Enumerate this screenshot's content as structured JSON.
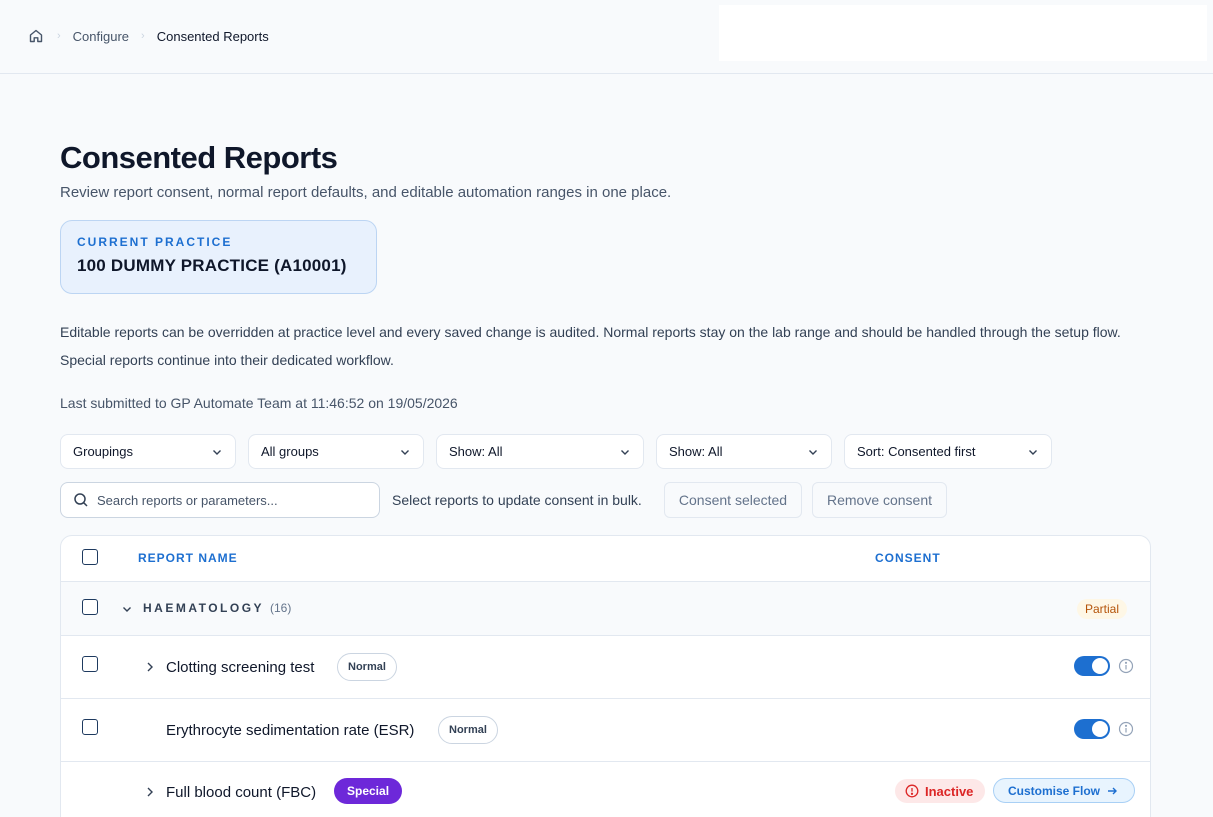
{
  "breadcrumb": {
    "items": [
      "Configure",
      "Consented Reports"
    ]
  },
  "page": {
    "title": "Consented Reports",
    "subtitle": "Review report consent, normal report defaults, and editable automation ranges in one place."
  },
  "practice": {
    "label": "CURRENT PRACTICE",
    "value": "100 DUMMY PRACTICE (A10001)"
  },
  "description": "Editable reports can be overridden at practice level and every saved change is audited. Normal reports stay on the lab range and should be handled through the setup flow. Special reports continue into their dedicated workflow.",
  "last_submitted": "Last submitted to GP Automate Team at 11:46:52 on 19/05/2026",
  "filters": [
    "Groupings",
    "All groups",
    "Show: All",
    "Show: All",
    "Sort: Consented first"
  ],
  "search": {
    "placeholder": "Search reports or parameters..."
  },
  "bulk": {
    "text": "Select reports to update consent in bulk.",
    "consent_label": "Consent selected",
    "remove_label": "Remove consent"
  },
  "table": {
    "headers": {
      "name": "REPORT NAME",
      "consent": "CONSENT"
    },
    "group": {
      "name": "HAEMATOLOGY",
      "count": "(16)",
      "status": "Partial"
    },
    "rows": [
      {
        "name": "Clotting screening test",
        "badge": "Normal",
        "consented": true
      },
      {
        "name": "Erythrocyte sedimentation rate (ESR)",
        "badge": "Normal",
        "consented": true
      },
      {
        "name": "Full blood count (FBC)",
        "badge": "Special",
        "status": "Inactive",
        "action": "Customise Flow"
      }
    ]
  },
  "colors": {
    "accent": "#1d6fd0",
    "special": "#6d28d9",
    "inactive": "#dc2626",
    "partial": "#b45309"
  }
}
